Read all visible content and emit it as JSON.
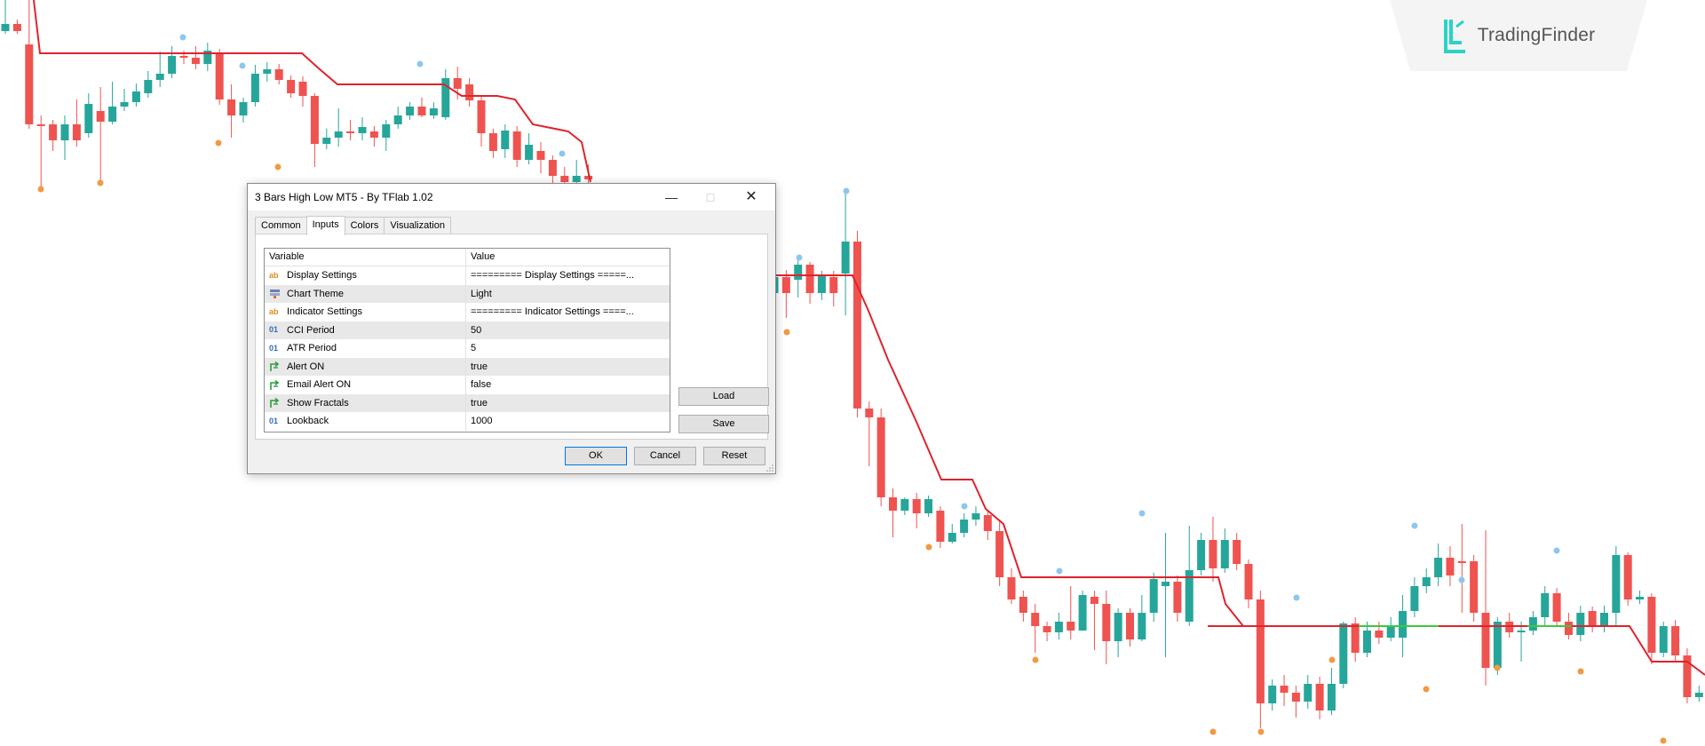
{
  "brand": {
    "name": "TradingFinder",
    "accent": "#2bd2c8"
  },
  "colors": {
    "bull": "#26a69a",
    "bear": "#ef5350",
    "line": "#e0232c",
    "line_alt": "#3cc93c",
    "fractal_high": "#8fc6ef",
    "fractal_low": "#ef9a45"
  },
  "dialog": {
    "title": "3 Bars High Low MT5 - By TFlab 1.02",
    "tabs": [
      {
        "label": "Common"
      },
      {
        "label": "Inputs",
        "active": true
      },
      {
        "label": "Colors"
      },
      {
        "label": "Visualization"
      }
    ],
    "table": {
      "headers": {
        "variable": "Variable",
        "value": "Value"
      },
      "rows": [
        {
          "icon": "text-param-icon",
          "name": "Display Settings",
          "value": "========= Display Settings =====..."
        },
        {
          "icon": "enum-param-icon",
          "name": "Chart Theme",
          "value": "Light"
        },
        {
          "icon": "text-param-icon",
          "name": "Indicator Settings",
          "value": "========= Indicator Settings ====..."
        },
        {
          "icon": "number-param-icon",
          "name": "CCI Period",
          "value": "50"
        },
        {
          "icon": "number-param-icon",
          "name": "ATR Period",
          "value": "5"
        },
        {
          "icon": "bool-param-icon",
          "name": "Alert ON",
          "value": "true"
        },
        {
          "icon": "bool-param-icon",
          "name": "Email Alert ON",
          "value": "false"
        },
        {
          "icon": "bool-param-icon",
          "name": "Show Fractals",
          "value": "true"
        },
        {
          "icon": "number-param-icon",
          "name": "Lookback",
          "value": "1000"
        }
      ]
    },
    "buttons": {
      "load": "Load",
      "save": "Save",
      "ok": "OK",
      "cancel": "Cancel",
      "reset": "Reset"
    }
  },
  "chart_data": {
    "type": "candlestick",
    "grid": false,
    "candles": [
      {
        "o": 35,
        "c": 27,
        "h": 0,
        "l": 38
      },
      {
        "o": 27,
        "c": 35,
        "h": 22,
        "l": 38
      },
      {
        "o": 50,
        "c": 140,
        "h": 0,
        "l": 145
      },
      {
        "o": 140,
        "c": 142,
        "h": 130,
        "l": 215
      },
      {
        "o": 140,
        "c": 158,
        "h": 135,
        "l": 170
      },
      {
        "o": 158,
        "c": 140,
        "h": 130,
        "l": 180
      },
      {
        "o": 140,
        "c": 158,
        "h": 112,
        "l": 165
      },
      {
        "o": 150,
        "c": 117,
        "h": 105,
        "l": 155
      },
      {
        "o": 125,
        "c": 137,
        "h": 98,
        "l": 205
      },
      {
        "o": 137,
        "c": 120,
        "h": 92,
        "l": 140
      },
      {
        "o": 120,
        "c": 115,
        "h": 100,
        "l": 125
      },
      {
        "o": 115,
        "c": 103,
        "h": 94,
        "l": 120
      },
      {
        "o": 105,
        "c": 90,
        "h": 80,
        "l": 110
      },
      {
        "o": 90,
        "c": 83,
        "h": 58,
        "l": 98
      },
      {
        "o": 83,
        "c": 63,
        "h": 52,
        "l": 88
      },
      {
        "o": 63,
        "c": 65,
        "h": 57,
        "l": 72
      },
      {
        "o": 65,
        "c": 72,
        "h": 52,
        "l": 78
      },
      {
        "o": 72,
        "c": 57,
        "h": 48,
        "l": 80
      },
      {
        "o": 60,
        "c": 112,
        "h": 55,
        "l": 118
      },
      {
        "o": 112,
        "c": 130,
        "h": 95,
        "l": 155
      },
      {
        "o": 130,
        "c": 115,
        "h": 110,
        "l": 138
      },
      {
        "o": 115,
        "c": 83,
        "h": 73,
        "l": 120
      },
      {
        "o": 83,
        "c": 78,
        "h": 70,
        "l": 92
      },
      {
        "o": 78,
        "c": 90,
        "h": 72,
        "l": 95
      },
      {
        "o": 90,
        "c": 105,
        "h": 85,
        "l": 110
      },
      {
        "o": 92,
        "c": 108,
        "h": 86,
        "l": 120
      },
      {
        "o": 108,
        "c": 162,
        "h": 105,
        "l": 188
      },
      {
        "o": 162,
        "c": 155,
        "h": 145,
        "l": 168
      },
      {
        "o": 155,
        "c": 148,
        "h": 122,
        "l": 165
      },
      {
        "o": 148,
        "c": 150,
        "h": 135,
        "l": 158
      },
      {
        "o": 150,
        "c": 143,
        "h": 132,
        "l": 158
      },
      {
        "o": 148,
        "c": 155,
        "h": 142,
        "l": 165
      },
      {
        "o": 155,
        "c": 140,
        "h": 135,
        "l": 170
      },
      {
        "o": 140,
        "c": 130,
        "h": 120,
        "l": 145
      },
      {
        "o": 130,
        "c": 120,
        "h": 115,
        "l": 135
      },
      {
        "o": 120,
        "c": 130,
        "h": 110,
        "l": 132
      },
      {
        "o": 130,
        "c": 122,
        "h": 115,
        "l": 134
      },
      {
        "o": 132,
        "c": 88,
        "h": 78,
        "l": 135
      },
      {
        "o": 88,
        "c": 100,
        "h": 75,
        "l": 112
      },
      {
        "o": 95,
        "c": 113,
        "h": 88,
        "l": 120
      },
      {
        "o": 113,
        "c": 150,
        "h": 108,
        "l": 165
      },
      {
        "o": 150,
        "c": 170,
        "h": 145,
        "l": 178
      },
      {
        "o": 168,
        "c": 147,
        "h": 140,
        "l": 178
      },
      {
        "o": 148,
        "c": 180,
        "h": 142,
        "l": 188
      },
      {
        "o": 180,
        "c": 163,
        "h": 150,
        "l": 185
      },
      {
        "o": 170,
        "c": 180,
        "h": 160,
        "l": 195
      },
      {
        "o": 180,
        "c": 198,
        "h": 175,
        "l": 210
      },
      {
        "o": 198,
        "c": 205,
        "h": 188,
        "l": 215
      },
      {
        "o": 205,
        "c": 198,
        "h": 180,
        "l": 212
      },
      {
        "o": 198,
        "c": 202,
        "h": 185,
        "l": 216
      }
    ],
    "candles_right": [
      {
        "o": 330,
        "c": 312,
        "h": 300,
        "l": 350
      },
      {
        "o": 312,
        "c": 330,
        "h": 304,
        "l": 358
      },
      {
        "o": 315,
        "c": 298,
        "h": 290,
        "l": 335
      },
      {
        "o": 298,
        "c": 330,
        "h": 295,
        "l": 342
      },
      {
        "o": 330,
        "c": 310,
        "h": 305,
        "l": 338
      },
      {
        "o": 312,
        "c": 330,
        "h": 305,
        "l": 345
      },
      {
        "o": 308,
        "c": 272,
        "h": 215,
        "l": 355
      },
      {
        "o": 272,
        "c": 460,
        "h": 260,
        "l": 470
      },
      {
        "o": 460,
        "c": 470,
        "h": 452,
        "l": 525
      },
      {
        "o": 470,
        "c": 560,
        "h": 460,
        "l": 570
      },
      {
        "o": 560,
        "c": 575,
        "h": 550,
        "l": 605
      },
      {
        "o": 575,
        "c": 562,
        "h": 560,
        "l": 580
      },
      {
        "o": 562,
        "c": 578,
        "h": 555,
        "l": 595
      },
      {
        "o": 578,
        "c": 562,
        "h": 558,
        "l": 582
      },
      {
        "o": 575,
        "c": 610,
        "h": 570,
        "l": 617
      },
      {
        "o": 610,
        "c": 600,
        "h": 590,
        "l": 612
      },
      {
        "o": 600,
        "c": 585,
        "h": 578,
        "l": 605
      },
      {
        "o": 585,
        "c": 578,
        "h": 570,
        "l": 592
      },
      {
        "o": 580,
        "c": 598,
        "h": 575,
        "l": 608
      },
      {
        "o": 598,
        "c": 650,
        "h": 585,
        "l": 660
      },
      {
        "o": 650,
        "c": 675,
        "h": 640,
        "l": 680
      },
      {
        "o": 672,
        "c": 690,
        "h": 665,
        "l": 700
      },
      {
        "o": 690,
        "c": 705,
        "h": 680,
        "l": 735
      },
      {
        "o": 705,
        "c": 712,
        "h": 700,
        "l": 722
      },
      {
        "o": 712,
        "c": 700,
        "h": 690,
        "l": 720
      },
      {
        "o": 700,
        "c": 710,
        "h": 660,
        "l": 720
      },
      {
        "o": 710,
        "c": 670,
        "h": 665,
        "l": 708
      },
      {
        "o": 672,
        "c": 680,
        "h": 665,
        "l": 732
      },
      {
        "o": 680,
        "c": 722,
        "h": 665,
        "l": 748
      },
      {
        "o": 722,
        "c": 690,
        "h": 685,
        "l": 740
      },
      {
        "o": 690,
        "c": 720,
        "h": 685,
        "l": 728
      },
      {
        "o": 720,
        "c": 690,
        "h": 670,
        "l": 722
      },
      {
        "o": 690,
        "c": 652,
        "h": 645,
        "l": 700
      },
      {
        "o": 660,
        "c": 655,
        "h": 600,
        "l": 740
      },
      {
        "o": 655,
        "c": 690,
        "h": 648,
        "l": 700
      },
      {
        "o": 700,
        "c": 642,
        "h": 592,
        "l": 705
      },
      {
        "o": 642,
        "c": 608,
        "h": 600,
        "l": 648
      },
      {
        "o": 608,
        "c": 640,
        "h": 582,
        "l": 655
      },
      {
        "o": 640,
        "c": 608,
        "h": 595,
        "l": 645
      },
      {
        "o": 608,
        "c": 635,
        "h": 600,
        "l": 642
      },
      {
        "o": 635,
        "c": 675,
        "h": 630,
        "l": 685
      },
      {
        "o": 675,
        "c": 792,
        "h": 665,
        "l": 820
      },
      {
        "o": 792,
        "c": 772,
        "h": 765,
        "l": 800
      },
      {
        "o": 772,
        "c": 780,
        "h": 760,
        "l": 795
      },
      {
        "o": 780,
        "c": 790,
        "h": 772,
        "l": 808
      },
      {
        "o": 790,
        "c": 770,
        "h": 760,
        "l": 798
      },
      {
        "o": 770,
        "c": 800,
        "h": 762,
        "l": 810
      },
      {
        "o": 800,
        "c": 770,
        "h": 752,
        "l": 805
      },
      {
        "o": 770,
        "c": 702,
        "h": 700,
        "l": 775
      },
      {
        "o": 702,
        "c": 735,
        "h": 695,
        "l": 745
      },
      {
        "o": 735,
        "c": 710,
        "h": 700,
        "l": 740
      },
      {
        "o": 710,
        "c": 718,
        "h": 700,
        "l": 725
      },
      {
        "o": 718,
        "c": 705,
        "h": 695,
        "l": 722
      },
      {
        "o": 718,
        "c": 688,
        "h": 670,
        "l": 740
      },
      {
        "o": 688,
        "c": 660,
        "h": 650,
        "l": 695
      },
      {
        "o": 660,
        "c": 650,
        "h": 640,
        "l": 668
      },
      {
        "o": 650,
        "c": 628,
        "h": 612,
        "l": 660
      },
      {
        "o": 628,
        "c": 648,
        "h": 615,
        "l": 660
      },
      {
        "o": 632,
        "c": 632,
        "h": 590,
        "l": 690
      },
      {
        "o": 632,
        "c": 690,
        "h": 625,
        "l": 700
      },
      {
        "o": 690,
        "c": 752,
        "h": 597,
        "l": 772
      },
      {
        "o": 752,
        "c": 700,
        "h": 695,
        "l": 760
      },
      {
        "o": 700,
        "c": 712,
        "h": 690,
        "l": 718
      },
      {
        "o": 712,
        "c": 710,
        "h": 700,
        "l": 745
      },
      {
        "o": 710,
        "c": 695,
        "h": 688,
        "l": 715
      },
      {
        "o": 695,
        "c": 668,
        "h": 660,
        "l": 705
      },
      {
        "o": 668,
        "c": 700,
        "h": 662,
        "l": 705
      },
      {
        "o": 700,
        "c": 715,
        "h": 690,
        "l": 720
      },
      {
        "o": 715,
        "c": 690,
        "h": 682,
        "l": 722
      },
      {
        "o": 688,
        "c": 705,
        "h": 683,
        "l": 712
      },
      {
        "o": 705,
        "c": 690,
        "h": 682,
        "l": 712
      },
      {
        "o": 690,
        "c": 625,
        "h": 615,
        "l": 705
      },
      {
        "o": 625,
        "c": 675,
        "h": 622,
        "l": 682
      },
      {
        "o": 675,
        "c": 672,
        "h": 665,
        "l": 680
      },
      {
        "o": 672,
        "c": 735,
        "h": 668,
        "l": 748
      },
      {
        "o": 735,
        "c": 705,
        "h": 700,
        "l": 740
      },
      {
        "o": 705,
        "c": 738,
        "h": 698,
        "l": 745
      },
      {
        "o": 738,
        "c": 785,
        "h": 730,
        "l": 792
      },
      {
        "o": 785,
        "c": 780,
        "h": 772,
        "l": 790
      },
      {
        "o": 780,
        "c": 775,
        "h": 768,
        "l": 785
      },
      {
        "o": 775,
        "c": 800,
        "h": 768,
        "l": 808
      },
      {
        "o": 800,
        "c": 762,
        "h": 755,
        "l": 805
      }
    ]
  }
}
